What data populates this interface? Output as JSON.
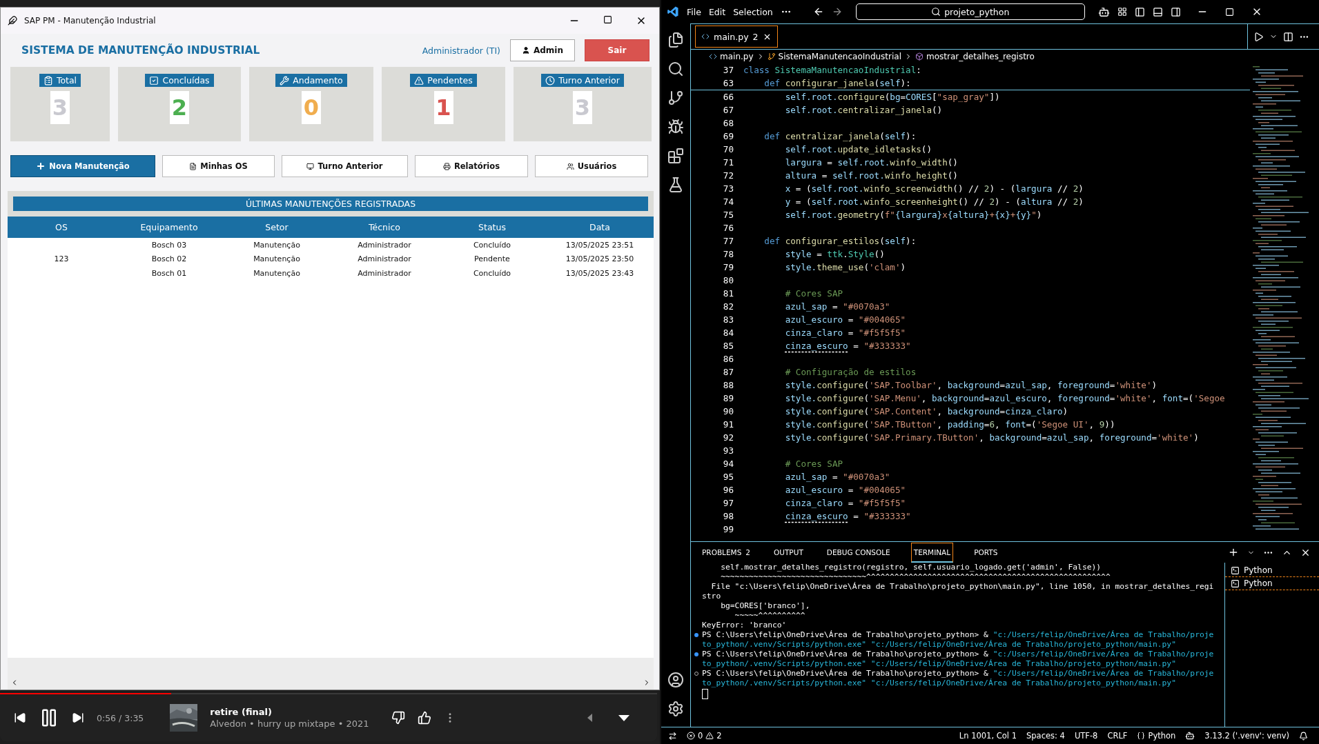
{
  "app_window": {
    "title": "SAP PM - Manutenção Industrial",
    "heading": "SISTEMA DE MANUTENÇÃO INDUSTRIAL",
    "user": "Administrador (TI)",
    "header_buttons": [
      {
        "label": "Admin",
        "kind": "plain"
      },
      {
        "label": "Sair",
        "kind": "danger"
      }
    ],
    "stats": [
      {
        "label": "Total",
        "kind": "total",
        "value": "3",
        "color": "#c9c9d0"
      },
      {
        "label": "Concluídas",
        "kind": "done",
        "value": "2",
        "color": "#4caf50"
      },
      {
        "label": "Andamento",
        "kind": "progress",
        "value": "0",
        "color": "#f0ad4e"
      },
      {
        "label": "Pendentes",
        "kind": "pending",
        "value": "1",
        "color": "#d9534f"
      },
      {
        "label": "Turno Anterior",
        "kind": "shift",
        "value": "3",
        "color": "#c9c9d0"
      }
    ],
    "actions": [
      {
        "label": "Nova Manutenção",
        "kind": "new"
      },
      {
        "label": "Minhas OS",
        "kind": "mine"
      },
      {
        "label": "Turno Anterior",
        "kind": "shift"
      },
      {
        "label": "Relatórios",
        "kind": "reports"
      },
      {
        "label": "Usuários",
        "kind": "users"
      }
    ],
    "table": {
      "title": "ÚLTIMAS MANUTENÇÕES REGISTRADAS",
      "columns": [
        "OS",
        "Equipamento",
        "Setor",
        "Técnico",
        "Status",
        "Data"
      ],
      "rows": [
        [
          "",
          "Bosch 03",
          "Manutenção",
          "Administrador",
          "Concluído",
          "13/05/2025 23:51"
        ],
        [
          "123",
          "Bosch 02",
          "Manutenção",
          "Administrador",
          "Pendente",
          "13/05/2025 23:50"
        ],
        [
          "",
          "Bosch 01",
          "Manutenção",
          "Administrador",
          "Concluído",
          "13/05/2025 23:43"
        ]
      ]
    }
  },
  "player": {
    "time": "0:56 / 3:35",
    "level": 0.26,
    "title": "retire (final)",
    "subtitle": "Alvedon • hurry up mixtape • 2021"
  },
  "editor": {
    "menu": [
      "File",
      "Edit",
      "Selection"
    ],
    "search": "projeto_python",
    "tab": {
      "label": "main.py",
      "badge": "2"
    },
    "breadcrumbs": [
      "main.py",
      "SistemaManutencaoIndustrial",
      "mostrar_detalhes_registro"
    ],
    "code": [
      {
        "n": "37",
        "code": [
          {
            "text": "class ",
            "kind": "keyword"
          },
          {
            "text": "SistemaManutencaoIndustrial",
            "kind": "class"
          },
          {
            "text": ":",
            "kind": "plain"
          }
        ]
      },
      {
        "n": "63",
        "code": [
          {
            "text": "    def ",
            "kind": "keyword"
          },
          {
            "text": "configurar_janela",
            "kind": "function"
          },
          {
            "text": "(",
            "kind": "plain"
          },
          {
            "text": "self",
            "kind": "variable"
          },
          {
            "text": "):",
            "kind": "plain"
          }
        ]
      },
      {
        "n": "66",
        "code": [
          {
            "text": "        self.root.",
            "kind": "variable"
          },
          {
            "text": "configure",
            "kind": "function"
          },
          {
            "text": "(",
            "kind": "plain"
          },
          {
            "text": "bg",
            "kind": "variable"
          },
          {
            "text": "=",
            "kind": "plain"
          },
          {
            "text": "CORES",
            "kind": "variable"
          },
          {
            "text": "[",
            "kind": "plain"
          },
          {
            "text": "\"sap_gray\"",
            "kind": "string"
          },
          {
            "text": "])",
            "kind": "plain"
          }
        ]
      },
      {
        "n": "67",
        "code": [
          {
            "text": "        self.root.",
            "kind": "variable"
          },
          {
            "text": "centralizar_janela",
            "kind": "function"
          },
          {
            "text": "()",
            "kind": "plain"
          }
        ]
      },
      {
        "n": "68"
      },
      {
        "n": "69",
        "code": [
          {
            "text": "    def ",
            "kind": "keyword"
          },
          {
            "text": "centralizar_janela",
            "kind": "function"
          },
          {
            "text": "(",
            "kind": "plain"
          },
          {
            "text": "self",
            "kind": "variable"
          },
          {
            "text": "):",
            "kind": "plain"
          }
        ]
      },
      {
        "n": "70",
        "code": [
          {
            "text": "        self.root.",
            "kind": "variable"
          },
          {
            "text": "update_idletasks",
            "kind": "function"
          },
          {
            "text": "()",
            "kind": "plain"
          }
        ]
      },
      {
        "n": "71",
        "code": [
          {
            "text": "        largura",
            "kind": "variable"
          },
          {
            "text": " = ",
            "kind": "plain"
          },
          {
            "text": "self.root.",
            "kind": "variable"
          },
          {
            "text": "winfo_width",
            "kind": "function"
          },
          {
            "text": "()",
            "kind": "plain"
          }
        ]
      },
      {
        "n": "72",
        "code": [
          {
            "text": "        altura",
            "kind": "variable"
          },
          {
            "text": " = ",
            "kind": "plain"
          },
          {
            "text": "self.root.",
            "kind": "variable"
          },
          {
            "text": "winfo_height",
            "kind": "function"
          },
          {
            "text": "()",
            "kind": "plain"
          }
        ]
      },
      {
        "n": "73",
        "code": [
          {
            "text": "        x",
            "kind": "variable"
          },
          {
            "text": " = (",
            "kind": "plain"
          },
          {
            "text": "self.root.",
            "kind": "variable"
          },
          {
            "text": "winfo_screenwidth",
            "kind": "function"
          },
          {
            "text": "() // ",
            "kind": "plain"
          },
          {
            "text": "2",
            "kind": "number"
          },
          {
            "text": ") - (",
            "kind": "plain"
          },
          {
            "text": "largura",
            "kind": "variable"
          },
          {
            "text": " // ",
            "kind": "plain"
          },
          {
            "text": "2",
            "kind": "number"
          },
          {
            "text": ")",
            "kind": "plain"
          }
        ]
      },
      {
        "n": "74",
        "code": [
          {
            "text": "        y",
            "kind": "variable"
          },
          {
            "text": " = (",
            "kind": "plain"
          },
          {
            "text": "self.root.",
            "kind": "variable"
          },
          {
            "text": "winfo_screenheight",
            "kind": "function"
          },
          {
            "text": "() // ",
            "kind": "plain"
          },
          {
            "text": "2",
            "kind": "number"
          },
          {
            "text": ") - (",
            "kind": "plain"
          },
          {
            "text": "altura",
            "kind": "variable"
          },
          {
            "text": " // ",
            "kind": "plain"
          },
          {
            "text": "2",
            "kind": "number"
          },
          {
            "text": ")",
            "kind": "plain"
          }
        ]
      },
      {
        "n": "75",
        "code": [
          {
            "text": "        self.root.",
            "kind": "variable"
          },
          {
            "text": "geometry",
            "kind": "function"
          },
          {
            "text": "(",
            "kind": "plain"
          },
          {
            "text": "f\"",
            "kind": "string"
          },
          {
            "text": "{largura}",
            "kind": "variable"
          },
          {
            "text": "x",
            "kind": "string"
          },
          {
            "text": "{altura}",
            "kind": "variable"
          },
          {
            "text": "+",
            "kind": "string"
          },
          {
            "text": "{x}",
            "kind": "variable"
          },
          {
            "text": "+",
            "kind": "string"
          },
          {
            "text": "{y}",
            "kind": "variable"
          },
          {
            "text": "\"",
            "kind": "string"
          },
          {
            "text": ")",
            "kind": "plain"
          }
        ]
      },
      {
        "n": "76"
      },
      {
        "n": "77",
        "code": [
          {
            "text": "    def ",
            "kind": "keyword"
          },
          {
            "text": "configurar_estilos",
            "kind": "function"
          },
          {
            "text": "(",
            "kind": "plain"
          },
          {
            "text": "self",
            "kind": "variable"
          },
          {
            "text": "):",
            "kind": "plain"
          }
        ]
      },
      {
        "n": "78",
        "code": [
          {
            "text": "        style",
            "kind": "variable"
          },
          {
            "text": " = ",
            "kind": "plain"
          },
          {
            "text": "ttk",
            "kind": "class"
          },
          {
            "text": ".",
            "kind": "plain"
          },
          {
            "text": "Style",
            "kind": "class"
          },
          {
            "text": "()",
            "kind": "plain"
          }
        ]
      },
      {
        "n": "79",
        "code": [
          {
            "text": "        style.",
            "kind": "variable"
          },
          {
            "text": "theme_use",
            "kind": "function"
          },
          {
            "text": "(",
            "kind": "plain"
          },
          {
            "text": "'clam'",
            "kind": "string"
          },
          {
            "text": ")",
            "kind": "plain"
          }
        ]
      },
      {
        "n": "80"
      },
      {
        "n": "81",
        "code": [
          {
            "text": "        # Cores SAP",
            "kind": "comment"
          }
        ]
      },
      {
        "n": "82",
        "code": [
          {
            "text": "        azul_sap",
            "kind": "variable"
          },
          {
            "text": " = ",
            "kind": "plain"
          },
          {
            "text": "\"#0070a3\"",
            "kind": "string"
          }
        ]
      },
      {
        "n": "83",
        "code": [
          {
            "text": "        azul_escuro",
            "kind": "variable"
          },
          {
            "text": " = ",
            "kind": "plain"
          },
          {
            "text": "\"#004065\"",
            "kind": "string"
          }
        ]
      },
      {
        "n": "84",
        "code": [
          {
            "text": "        cinza_claro",
            "kind": "variable"
          },
          {
            "text": " = ",
            "kind": "plain"
          },
          {
            "text": "\"#f5f5f5\"",
            "kind": "string"
          }
        ]
      },
      {
        "n": "85",
        "code": [
          {
            "text": "        cinza_escuro",
            "kind": "warning"
          },
          {
            "text": " = ",
            "kind": "plain"
          },
          {
            "text": "\"#333333\"",
            "kind": "string"
          }
        ]
      },
      {
        "n": "86"
      },
      {
        "n": "87",
        "code": [
          {
            "text": "        # Configuração de estilos",
            "kind": "comment"
          }
        ]
      },
      {
        "n": "88",
        "code": [
          {
            "text": "        style.",
            "kind": "variable"
          },
          {
            "text": "configure",
            "kind": "function"
          },
          {
            "text": "(",
            "kind": "plain"
          },
          {
            "text": "'SAP.Toolbar'",
            "kind": "string"
          },
          {
            "text": ", ",
            "kind": "plain"
          },
          {
            "text": "background",
            "kind": "variable"
          },
          {
            "text": "=",
            "kind": "plain"
          },
          {
            "text": "azul_sap",
            "kind": "variable"
          },
          {
            "text": ", ",
            "kind": "plain"
          },
          {
            "text": "foreground",
            "kind": "variable"
          },
          {
            "text": "=",
            "kind": "plain"
          },
          {
            "text": "'white'",
            "kind": "string"
          },
          {
            "text": ")",
            "kind": "plain"
          }
        ]
      },
      {
        "n": "89",
        "code": [
          {
            "text": "        style.",
            "kind": "variable"
          },
          {
            "text": "configure",
            "kind": "function"
          },
          {
            "text": "(",
            "kind": "plain"
          },
          {
            "text": "'SAP.Menu'",
            "kind": "string"
          },
          {
            "text": ", ",
            "kind": "plain"
          },
          {
            "text": "background",
            "kind": "variable"
          },
          {
            "text": "=",
            "kind": "plain"
          },
          {
            "text": "azul_escuro",
            "kind": "variable"
          },
          {
            "text": ", ",
            "kind": "plain"
          },
          {
            "text": "foreground",
            "kind": "variable"
          },
          {
            "text": "=",
            "kind": "plain"
          },
          {
            "text": "'white'",
            "kind": "string"
          },
          {
            "text": ", ",
            "kind": "plain"
          },
          {
            "text": "font",
            "kind": "variable"
          },
          {
            "text": "=(",
            "kind": "plain"
          },
          {
            "text": "'Segoe",
            "kind": "string"
          }
        ]
      },
      {
        "n": "90",
        "code": [
          {
            "text": "        style.",
            "kind": "variable"
          },
          {
            "text": "configure",
            "kind": "function"
          },
          {
            "text": "(",
            "kind": "plain"
          },
          {
            "text": "'SAP.Content'",
            "kind": "string"
          },
          {
            "text": ", ",
            "kind": "plain"
          },
          {
            "text": "background",
            "kind": "variable"
          },
          {
            "text": "=",
            "kind": "plain"
          },
          {
            "text": "cinza_claro",
            "kind": "variable"
          },
          {
            "text": ")",
            "kind": "plain"
          }
        ]
      },
      {
        "n": "91",
        "code": [
          {
            "text": "        style.",
            "kind": "variable"
          },
          {
            "text": "configure",
            "kind": "function"
          },
          {
            "text": "(",
            "kind": "plain"
          },
          {
            "text": "'SAP.TButton'",
            "kind": "string"
          },
          {
            "text": ", ",
            "kind": "plain"
          },
          {
            "text": "padding",
            "kind": "variable"
          },
          {
            "text": "=",
            "kind": "plain"
          },
          {
            "text": "6",
            "kind": "number"
          },
          {
            "text": ", ",
            "kind": "plain"
          },
          {
            "text": "font",
            "kind": "variable"
          },
          {
            "text": "=(",
            "kind": "plain"
          },
          {
            "text": "'Segoe UI'",
            "kind": "string"
          },
          {
            "text": ", ",
            "kind": "plain"
          },
          {
            "text": "9",
            "kind": "number"
          },
          {
            "text": "))",
            "kind": "plain"
          }
        ]
      },
      {
        "n": "92",
        "code": [
          {
            "text": "        style.",
            "kind": "variable"
          },
          {
            "text": "configure",
            "kind": "function"
          },
          {
            "text": "(",
            "kind": "plain"
          },
          {
            "text": "'SAP.Primary.TButton'",
            "kind": "string"
          },
          {
            "text": ", ",
            "kind": "plain"
          },
          {
            "text": "background",
            "kind": "variable"
          },
          {
            "text": "=",
            "kind": "plain"
          },
          {
            "text": "azul_sap",
            "kind": "variable"
          },
          {
            "text": ", ",
            "kind": "plain"
          },
          {
            "text": "foreground",
            "kind": "variable"
          },
          {
            "text": "=",
            "kind": "plain"
          },
          {
            "text": "'white'",
            "kind": "string"
          },
          {
            "text": ")",
            "kind": "plain"
          }
        ]
      },
      {
        "n": "93"
      },
      {
        "n": "94",
        "code": [
          {
            "text": "        # Cores SAP",
            "kind": "comment"
          }
        ]
      },
      {
        "n": "95",
        "code": [
          {
            "text": "        azul_sap",
            "kind": "variable"
          },
          {
            "text": " = ",
            "kind": "plain"
          },
          {
            "text": "\"#0070a3\"",
            "kind": "string"
          }
        ]
      },
      {
        "n": "96",
        "code": [
          {
            "text": "        azul_escuro",
            "kind": "variable"
          },
          {
            "text": " = ",
            "kind": "plain"
          },
          {
            "text": "\"#004065\"",
            "kind": "string"
          }
        ]
      },
      {
        "n": "97",
        "code": [
          {
            "text": "        cinza_claro",
            "kind": "variable"
          },
          {
            "text": " = ",
            "kind": "plain"
          },
          {
            "text": "\"#f5f5f5\"",
            "kind": "string"
          }
        ]
      },
      {
        "n": "98",
        "code": [
          {
            "text": "        cinza_escuro",
            "kind": "warning"
          },
          {
            "text": " = ",
            "kind": "plain"
          },
          {
            "text": "\"#333333\"",
            "kind": "string"
          }
        ]
      },
      {
        "n": "99"
      }
    ],
    "panel_tabs": [
      {
        "label": "PROBLEMS",
        "badge": "2",
        "selected": false
      },
      {
        "label": "OUTPUT",
        "selected": false
      },
      {
        "label": "DEBUG CONSOLE",
        "selected": false
      },
      {
        "label": "TERMINAL",
        "selected": true
      },
      {
        "label": "PORTS",
        "selected": false
      }
    ],
    "terminal": [
      {
        "kind": "plain",
        "text": "    self.mostrar_detalhes_registro(registro, self.usuario_logado.get('admin', False))"
      },
      {
        "kind": "plain",
        "text": "    ~~~~~~~~~~~~~~~~~~~~~~~~~~~~~~~^^^^^^^^^^^^^^^^^^^^^^^^^^^^^^^^^^^^^^^^^^^^^^^^^^^^"
      },
      {
        "kind": "plain",
        "text": "  File \"c:\\Users\\felip\\OneDrive\\Área de Trabalho\\projeto_python\\main.py\", line 1050, in mostrar_detalhes_registro"
      },
      {
        "kind": "plain",
        "text": "    bg=CORES['branco'],"
      },
      {
        "kind": "plain",
        "text": "       ~~~~~^^^^^^^^^^"
      },
      {
        "kind": "plain",
        "text": "KeyError: 'branco'"
      },
      {
        "kind": "success",
        "prompt": "PS C:\\Users\\felip\\OneDrive\\Área de Trabalho\\projeto_python> & ",
        "text": "\"c:/Users/felip/OneDrive/Área de Trabalho/projeto_python/.venv/Scripts/python.exe\" \"c:/Users/felip/OneDrive/Área de Trabalho/projeto_python/main.py\""
      },
      {
        "kind": "success",
        "prompt": "PS C:\\Users\\felip\\OneDrive\\Área de Trabalho\\projeto_python> & ",
        "text": "\"c:/Users/felip/OneDrive/Área de Trabalho/projeto_python/.venv/Scripts/python.exe\" \"c:/Users/felip/OneDrive/Área de Trabalho/projeto_python/main.py\""
      },
      {
        "kind": "idle",
        "prompt": "PS C:\\Users\\felip\\OneDrive\\Área de Trabalho\\projeto_python> & ",
        "text": "\"c:/Users/felip/OneDrive/Área de Trabalho/projeto_python/.venv/Scripts/python.exe\" \"c:/Users/felip/OneDrive/Área de Trabalho/projeto_python/main.py\""
      }
    ],
    "terminals": [
      {
        "label": "Python",
        "selected": false
      },
      {
        "label": "Python",
        "selected": true
      }
    ],
    "status": {
      "errors": "0",
      "warnings": "2",
      "items": [
        "Ln 1001, Col 1",
        "Spaces: 4",
        "UTF-8",
        "CRLF"
      ],
      "language": "Python",
      "interpreter": "3.13.2 ('.venv': venv)"
    }
  }
}
